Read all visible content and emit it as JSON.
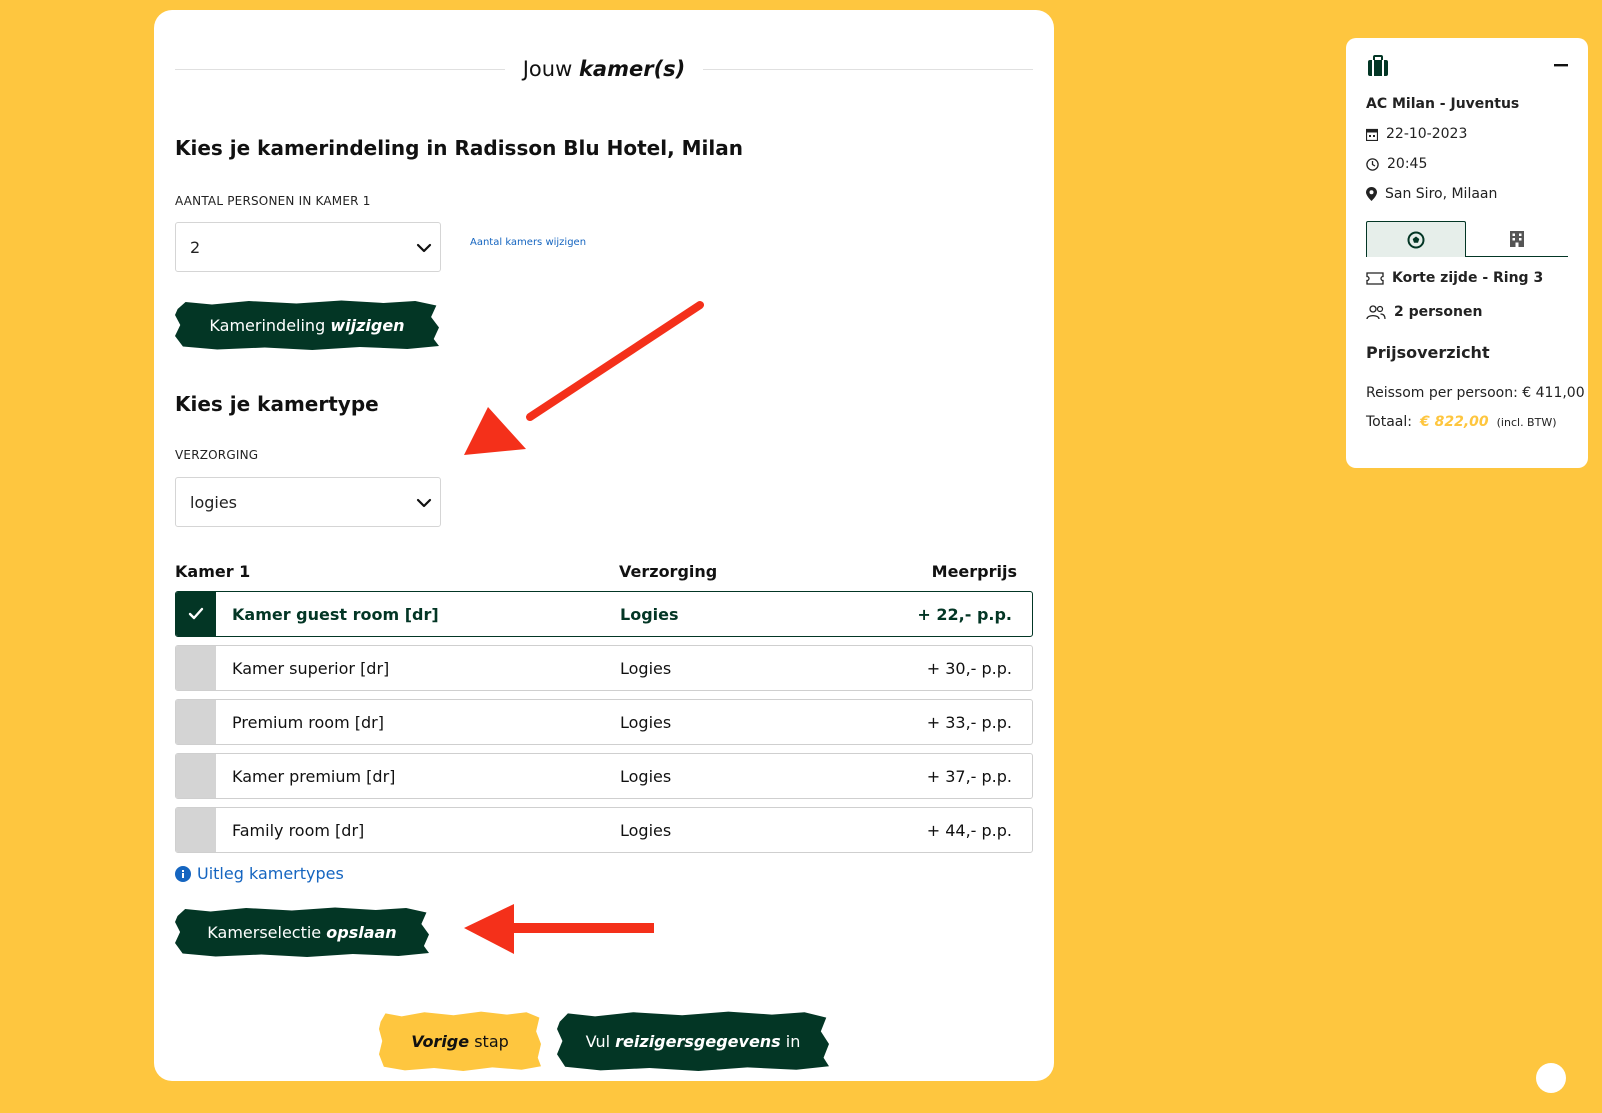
{
  "section": {
    "title_pre": "Jouw",
    "title_em": "kamer(s)"
  },
  "layout": {
    "heading": "Kies je kamerindeling in Radisson Blu Hotel, Milan",
    "persons_label": "AANTAL PERSONEN IN KAMER 1",
    "persons_value": "2",
    "change_rooms_link": "Aantal kamers wijzigen",
    "change_button": {
      "text": "Kamerindeling",
      "em": "wijzigen"
    }
  },
  "roomtype": {
    "heading": "Kies je kamertype",
    "board_label": "VERZORGING",
    "board_value": "logies"
  },
  "table": {
    "headers": {
      "room": "Kamer 1",
      "board": "Verzorging",
      "price": "Meerprijs"
    },
    "rows": [
      {
        "name": "Kamer guest room [dr]",
        "board": "Logies",
        "price": "+ 22,- p.p.",
        "selected": true
      },
      {
        "name": "Kamer superior [dr]",
        "board": "Logies",
        "price": "+ 30,- p.p.",
        "selected": false
      },
      {
        "name": "Premium room [dr]",
        "board": "Logies",
        "price": "+ 33,- p.p.",
        "selected": false
      },
      {
        "name": "Kamer premium [dr]",
        "board": "Logies",
        "price": "+ 37,- p.p.",
        "selected": false
      },
      {
        "name": "Family room [dr]",
        "board": "Logies",
        "price": "+ 44,- p.p.",
        "selected": false
      }
    ]
  },
  "info_link": "Uitleg kamertypes",
  "save_button": {
    "text": "Kamerselectie",
    "em": "opslaan"
  },
  "nav": {
    "prev": {
      "em": "Vorige",
      "text": "stap"
    },
    "next": {
      "pre": "Vul",
      "em": "reizigersgegevens",
      "post": "in"
    }
  },
  "sidebar": {
    "match": "AC Milan - Juventus",
    "date": "22-10-2023",
    "time": "20:45",
    "venue": "San Siro, Milaan",
    "seat": "Korte zijde - Ring 3",
    "persons": "2 personen",
    "price_heading": "Prijsoverzicht",
    "per_person": "Reissom per persoon: € 411,00",
    "total_label": "Totaal:",
    "total_value": "€ 822,00",
    "total_note": "(incl. BTW)"
  },
  "colors": {
    "background": "#fec63f",
    "brand_green": "#033625",
    "link_blue": "#1565c0",
    "total_accent": "#fec63f",
    "arrow_red": "#f4301a"
  }
}
